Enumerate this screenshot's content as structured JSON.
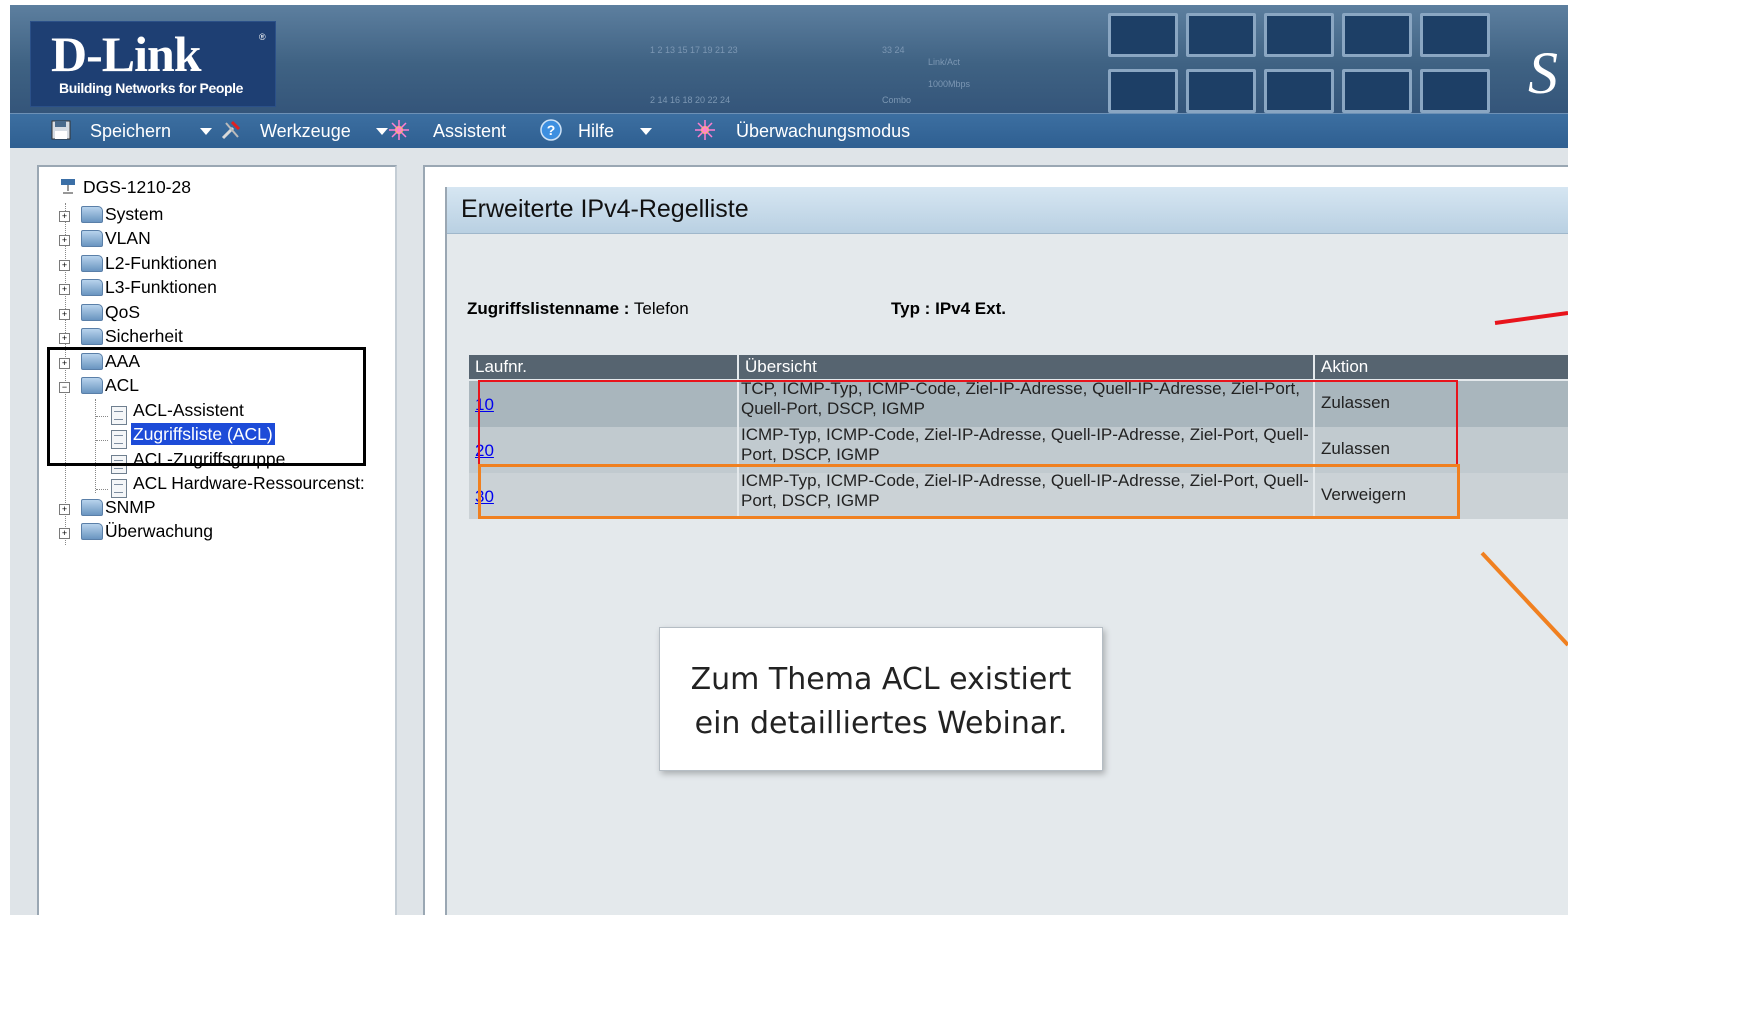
{
  "brand": {
    "name": "D-Link",
    "tagline": "Building Networks for People"
  },
  "device_panel": {
    "port_labels": [
      "1 2 13 15 17 19 21 23",
      "33 24",
      "Link/Act",
      "1000Mbps",
      "2 14 16 18 20 22 24",
      "Combo"
    ]
  },
  "header_logo_fragment": "S",
  "menubar": {
    "save": "Speichern",
    "tools": "Werkzeuge",
    "wizard": "Assistent",
    "help": "Hilfe",
    "monitor": "Überwachungsmodus"
  },
  "tree": {
    "root": "DGS-1210-28",
    "system": "System",
    "vlan": "VLAN",
    "l2": "L2-Funktionen",
    "l3": "L3-Funktionen",
    "qos": "QoS",
    "security": "Sicherheit",
    "aaa": "AAA",
    "acl": "ACL",
    "acl_children": [
      "ACL-Assistent",
      "Zugriffsliste (ACL)",
      "ACL-Zugriffsgruppe",
      "ACL Hardware-Ressourcenst:"
    ],
    "snmp": "SNMP",
    "monitoring": "Überwachung"
  },
  "page": {
    "title": "Erweiterte IPv4-Regelliste",
    "list_name_label": "Zugriffslistenname :",
    "list_name_value": "Telefon",
    "type_label": "Typ :",
    "type_value": "IPv4 Ext."
  },
  "table": {
    "headers": [
      "Laufnr.",
      "Übersicht",
      "Aktion"
    ],
    "rows": [
      {
        "id": "10",
        "summary": " TCP, ICMP-Typ, ICMP-Code, Ziel-IP-Adresse, Quell-IP-Adresse, Ziel-Port, Quell-Port, DSCP, IGMP",
        "action": "Zulassen"
      },
      {
        "id": "20",
        "summary": " ICMP-Typ, ICMP-Code, Ziel-IP-Adresse, Quell-IP-Adresse, Ziel-Port, Quell-Port, DSCP, IGMP",
        "action": "Zulassen"
      },
      {
        "id": "30",
        "summary": " ICMP-Typ, ICMP-Code, Ziel-IP-Adresse, Quell-IP-Adresse, Ziel-Port, Quell-Port, DSCP, IGMP",
        "action": "Verweigern"
      }
    ]
  },
  "note": {
    "line1": "Zum Thema ACL existiert",
    "line2": "ein detailliertes Webinar."
  },
  "colors": {
    "highlight_black": "#000000",
    "highlight_red": "#e8141c",
    "highlight_orange": "#f08020",
    "menubar": "#2f5f91",
    "selection": "#1d4bd8"
  }
}
